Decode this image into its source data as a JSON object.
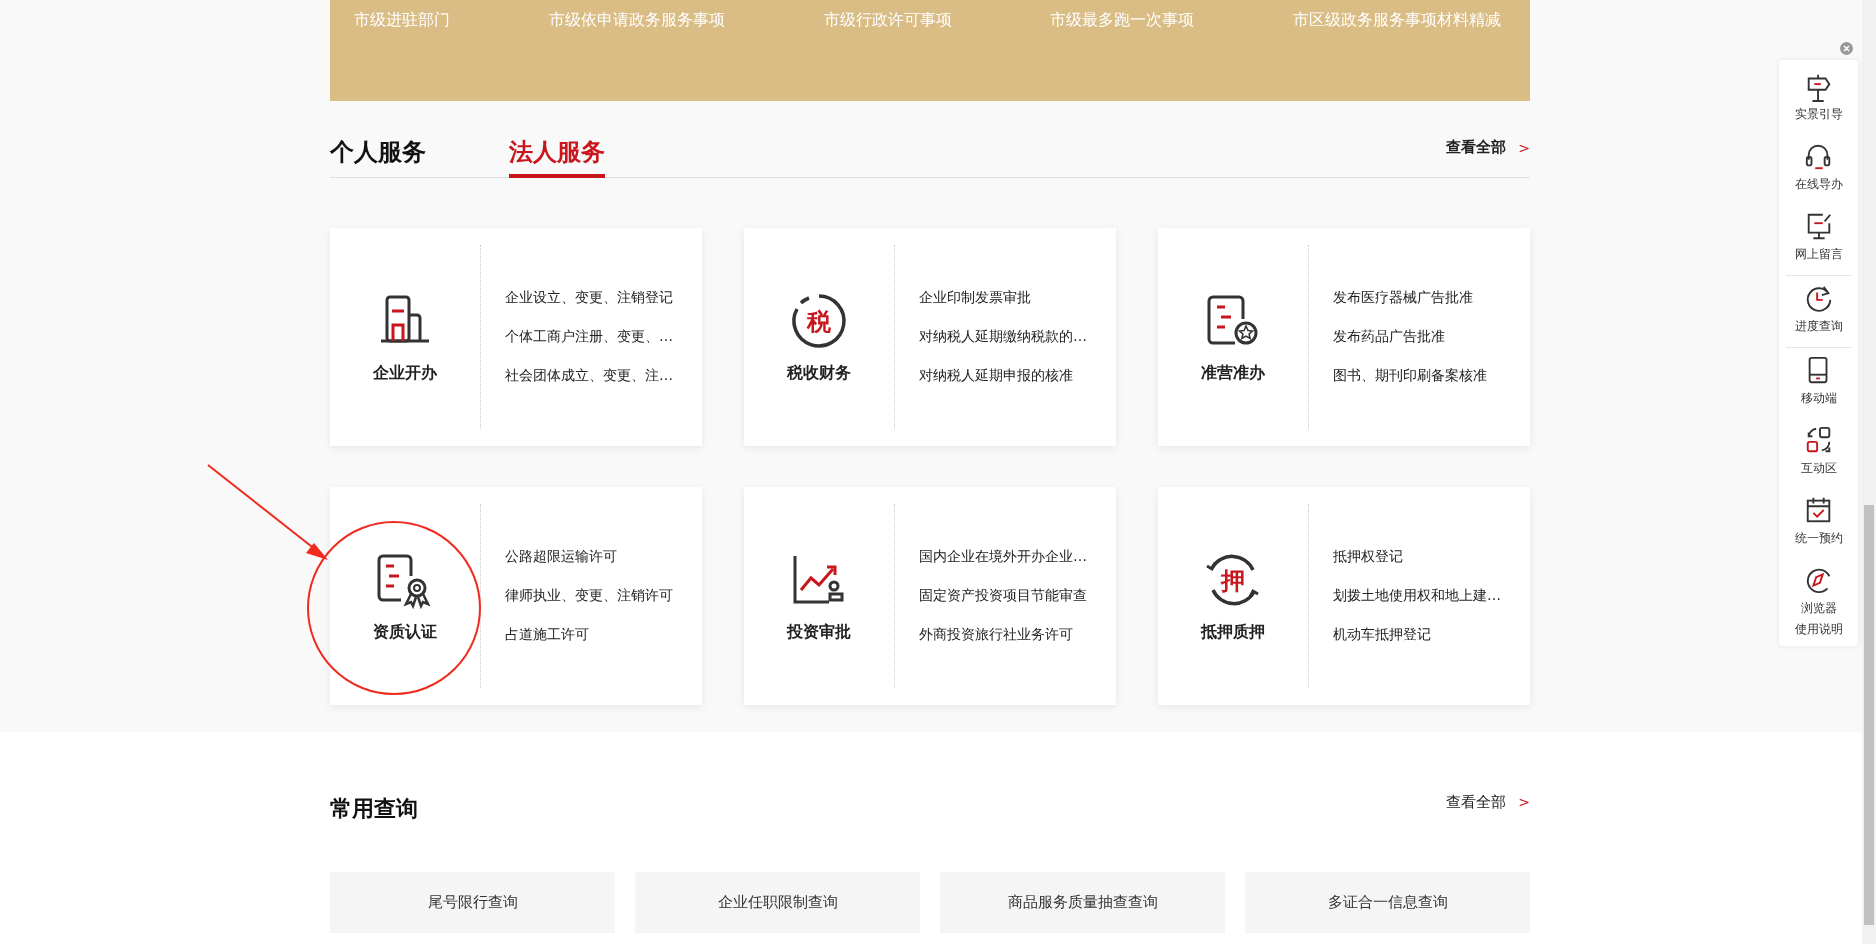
{
  "banner_links": [
    "市级进驻部门",
    "市级依申请政务服务事项",
    "市级行政许可事项",
    "市级最多跑一次事项",
    "市区级政务服务事项材料精减"
  ],
  "service_tabs": [
    {
      "label": "个人服务",
      "selected": false
    },
    {
      "label": "法人服务",
      "selected": true
    }
  ],
  "service_view_all": "查看全部",
  "service_view_all_arrow": ">",
  "categories": [
    {
      "name": "企业开办",
      "kind": "building",
      "items": [
        "企业设立、变更、注销登记",
        "个体工商户注册、变更、…",
        "社会团体成立、变更、注…"
      ]
    },
    {
      "name": "税收财务",
      "kind": "seal",
      "icon_text": "税",
      "items": [
        "企业印制发票审批",
        "对纳税人延期缴纳税款的…",
        "对纳税人延期申报的核准"
      ]
    },
    {
      "name": "准营准办",
      "kind": "document",
      "items": [
        "发布医疗器械广告批准",
        "发布药品广告批准",
        "图书、期刊印刷备案核准"
      ]
    },
    {
      "name": "资质认证",
      "kind": "certificate",
      "items": [
        "公路超限运输许可",
        "律师执业、变更、注销许可",
        "占道施工许可"
      ]
    },
    {
      "name": "投资审批",
      "kind": "chart",
      "items": [
        "国内企业在境外开办企业…",
        "固定资产投资项目节能审查",
        "外商投资旅行社业务许可"
      ]
    },
    {
      "name": "抵押质押",
      "kind": "cycle",
      "icon_text": "押",
      "items": [
        "抵押权登记",
        "划拨土地使用权和地上建…",
        "机动车抵押登记"
      ]
    }
  ],
  "query_section": {
    "title": "常用查询",
    "view_all": "查看全部",
    "view_all_arrow": ">",
    "buttons": [
      "尾号限行查询",
      "企业任职限制查询",
      "商品服务质量抽查查询",
      "多证合一信息查询"
    ]
  },
  "sidebar": {
    "items": [
      {
        "lines": [
          "实景引导"
        ],
        "kind": "signpost"
      },
      {
        "lines": [
          "在线导办"
        ],
        "kind": "headset"
      },
      {
        "lines": [
          "网上留言"
        ],
        "kind": "monitor"
      },
      {
        "lines": [
          "进度查询"
        ],
        "kind": "clock"
      },
      {
        "lines": [
          "移动端"
        ],
        "kind": "tablet"
      },
      {
        "lines": [
          "互动区"
        ],
        "kind": "swap"
      },
      {
        "lines": [
          "统一预约"
        ],
        "kind": "calendar"
      },
      {
        "lines": [
          "浏览器",
          "使用说明"
        ],
        "kind": "compass"
      }
    ]
  }
}
